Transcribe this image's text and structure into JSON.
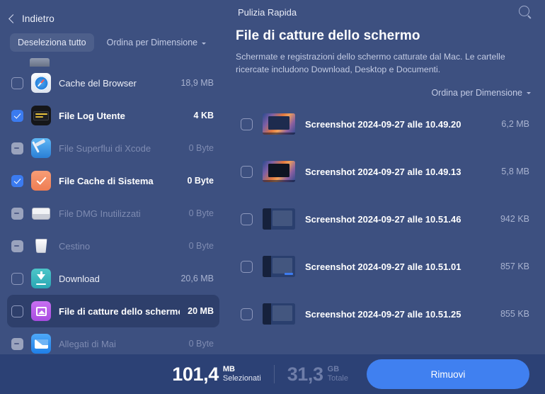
{
  "header": {
    "back_label": "Indietro",
    "deselect_all_label": "Deseleziona tutto",
    "sort_label": "Ordina per Dimensione",
    "app_section_title": "Pulizia Rapida"
  },
  "sidebar": {
    "items": [
      {
        "label": "Cache del Browser",
        "size": "18,9 MB",
        "checkbox": "empty",
        "icon": "safari-icon",
        "state": "normal"
      },
      {
        "label": "File Log Utente",
        "size": "4 KB",
        "checkbox": "checked",
        "icon": "console-icon",
        "state": "normal"
      },
      {
        "label": "File Superflui di Xcode",
        "size": "0 Byte",
        "checkbox": "mixed",
        "icon": "xcode-icon",
        "state": "dim"
      },
      {
        "label": "File Cache di Sistema",
        "size": "0 Byte",
        "checkbox": "checked",
        "icon": "system-cache-icon",
        "state": "normal"
      },
      {
        "label": "File DMG Inutilizzati",
        "size": "0 Byte",
        "checkbox": "mixed",
        "icon": "disk-image-icon",
        "state": "dim"
      },
      {
        "label": "Cestino",
        "size": "0 Byte",
        "checkbox": "mixed",
        "icon": "trash-icon",
        "state": "dim"
      },
      {
        "label": "Download",
        "size": "20,6 MB",
        "checkbox": "empty",
        "icon": "download-icon",
        "state": "normal"
      },
      {
        "label": "File di catture dello schermo",
        "size": "20 MB",
        "checkbox": "empty",
        "icon": "screenshots-icon",
        "state": "selected"
      },
      {
        "label": "Allegati di Mai",
        "size": "0 Byte",
        "checkbox": "mixed",
        "icon": "mail-icon",
        "state": "dim"
      }
    ]
  },
  "detail": {
    "title": "File di catture dello schermo",
    "description": "Schermate e registrazioni dello schermo catturate dal Mac. Le cartelle ricercate includono Download, Desktop e Documenti.",
    "sort_label": "Ordina per Dimensione",
    "files": [
      {
        "name": "Screenshot 2024-09-27 alle 10.49.20",
        "size": "6,2 MB",
        "checkbox": "empty",
        "thumb": "desktop-light"
      },
      {
        "name": "Screenshot 2024-09-27 alle 10.49.13",
        "size": "5,8 MB",
        "checkbox": "empty",
        "thumb": "desktop-dark"
      },
      {
        "name": "Screenshot 2024-09-27 alle 10.51.46",
        "size": "942 KB",
        "checkbox": "empty",
        "thumb": "ui"
      },
      {
        "name": "Screenshot 2024-09-27 alle 10.51.01",
        "size": "857 KB",
        "checkbox": "empty",
        "thumb": "ui"
      },
      {
        "name": "Screenshot 2024-09-27 alle 10.51.25",
        "size": "855 KB",
        "checkbox": "empty",
        "thumb": "ui"
      }
    ]
  },
  "footer": {
    "selected_value": "101,4",
    "selected_unit": "MB",
    "selected_word": "Selezionati",
    "total_value": "31,3",
    "total_unit": "GB",
    "total_word": "Totale",
    "remove_label": "Rimuovi"
  },
  "colors": {
    "background": "#3d5080",
    "bottom_bar": "#2c4175",
    "selected_row": "#2e3f6b",
    "accent_button": "#4080f0",
    "checkbox_checked": "#3b7bf0"
  }
}
